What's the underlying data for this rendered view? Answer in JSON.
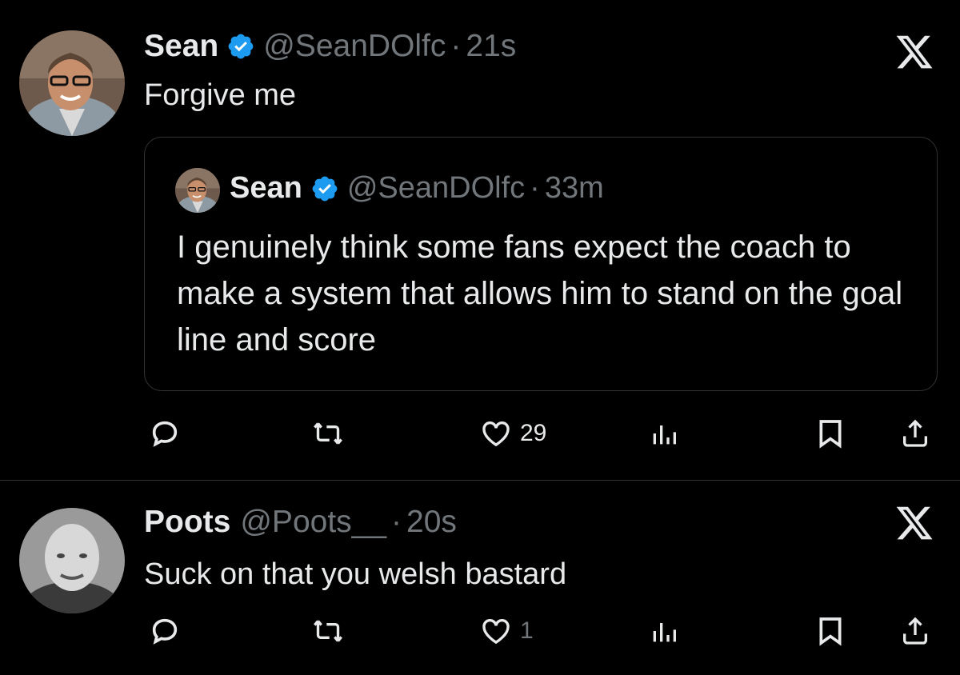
{
  "tweets": [
    {
      "name": "Sean",
      "handle": "@SeanDOlfc",
      "dot": "·",
      "time": "21s",
      "text": "Forgive me",
      "quote": {
        "name": "Sean",
        "handle": "@SeanDOlfc",
        "dot": "·",
        "time": "33m",
        "text": "I genuinely think some fans expect the coach to make a system that allows him to stand on the goal line and score"
      },
      "actions": {
        "likes": "29"
      }
    },
    {
      "name": "Poots",
      "handle": "@Poots__",
      "dot": "·",
      "time": "20s",
      "text": "Suck on that you welsh bastard",
      "actions": {
        "likes": "1"
      }
    }
  ],
  "colors": {
    "background": "#000000",
    "text": "#e7e9ea",
    "muted": "#71767b",
    "verified": "#1d9bf0",
    "border": "#2f3336"
  },
  "icons": [
    "x-logo-icon",
    "verified-badge-icon",
    "reply-icon",
    "retweet-icon",
    "like-icon",
    "views-icon",
    "bookmark-icon",
    "share-icon"
  ]
}
